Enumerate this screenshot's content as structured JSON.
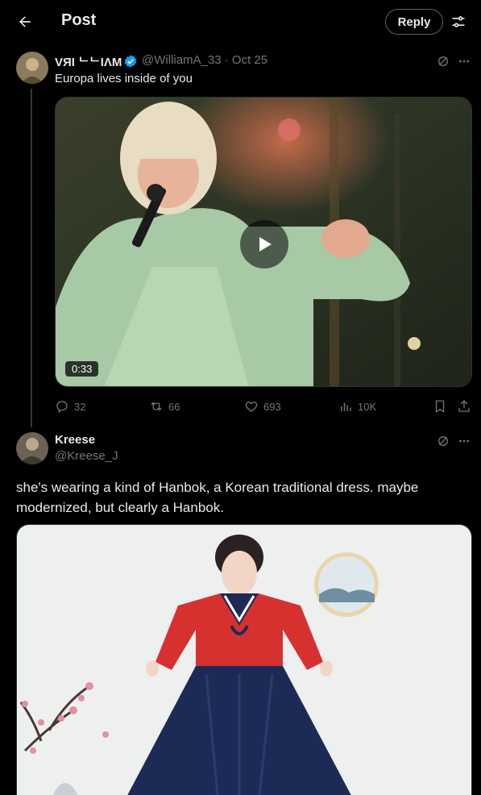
{
  "header": {
    "title": "Post",
    "reply_button": "Reply"
  },
  "tweet": {
    "author_name": "VЯI ᄂᄂIΛM",
    "handle_date": "@WilliamA_33 · Oct 25",
    "text": "Europa lives inside of you",
    "video_duration": "0:33",
    "stats": {
      "replies": "32",
      "reposts": "66",
      "likes": "693",
      "views": "10K"
    }
  },
  "reply": {
    "author_name": "Kreese",
    "handle": "@Kreese_J",
    "text": "she's wearing a kind of Hanbok, a Korean traditional dress. maybe modernized, but clearly a Hanbok."
  },
  "colors": {
    "background": "#000000",
    "text": "#e7e9ea",
    "muted": "#71767b",
    "verified_blue": "#1d9bf0",
    "border": "#2f3336"
  }
}
